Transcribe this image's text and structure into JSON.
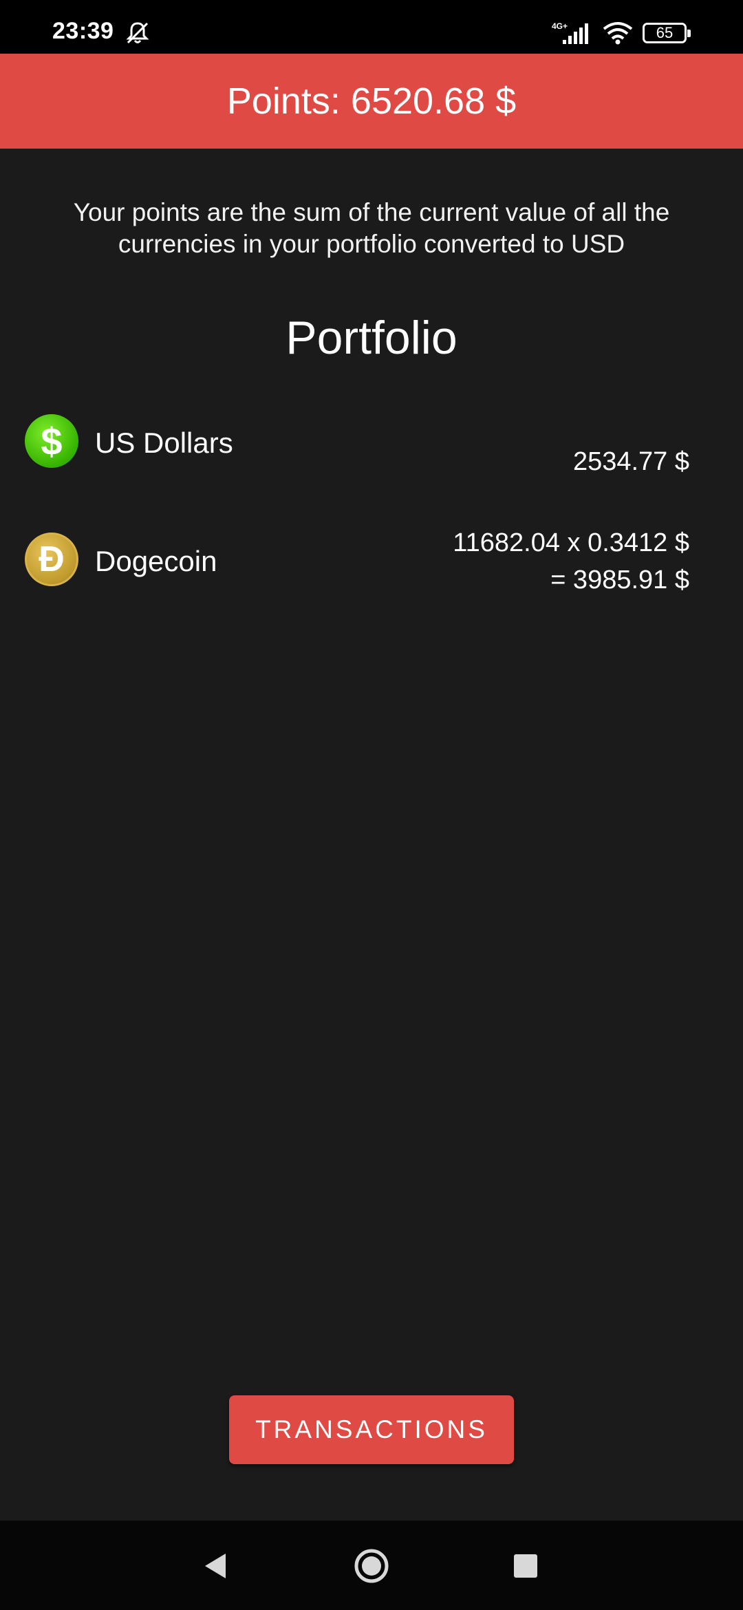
{
  "status_bar": {
    "time": "23:39",
    "network": "4G+",
    "battery": "65",
    "icons": [
      "bell-off-icon",
      "signal-icon",
      "wifi-icon",
      "battery-icon"
    ]
  },
  "header": {
    "points_text": "Points: 6520.68 $",
    "color": "#e04a44"
  },
  "description": "Your points are the sum of the current value of all the currencies in your portfolio converted to USD",
  "portfolio": {
    "title": "Portfolio",
    "items": [
      {
        "name": "US Dollars",
        "icon": "dollar-coin-icon",
        "symbol": "$",
        "value_line1": "",
        "value_line2": "2534.77 $"
      },
      {
        "name": "Dogecoin",
        "icon": "dogecoin-icon",
        "symbol": "Ð",
        "value_line1": "11682.04 x 0.3412 $",
        "value_line2": "= 3985.91 $"
      }
    ]
  },
  "transactions_button": "TRANSACTIONS",
  "nav": {
    "icons": [
      "back-icon",
      "home-icon",
      "recents-icon"
    ]
  }
}
